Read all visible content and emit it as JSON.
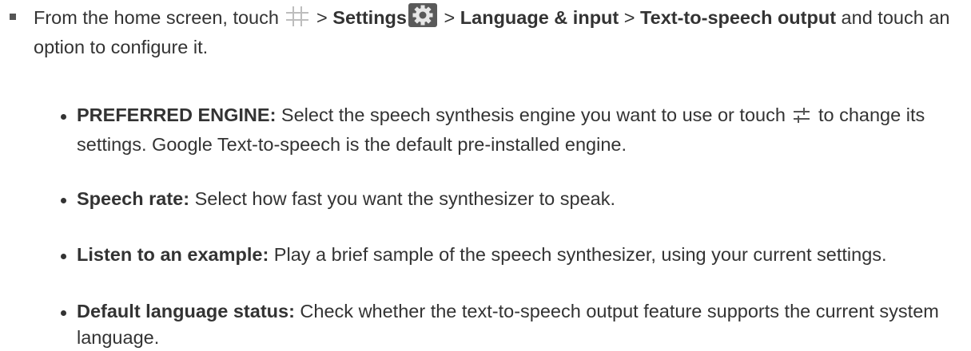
{
  "main_step": {
    "pre": "From the home screen, touch ",
    "sep1": " > ",
    "settings": "Settings",
    "sep2": " > ",
    "language_input": "Language & input",
    "sep3": " > ",
    "tts_output": "Text-to-speech output",
    "post": " and touch an option to configure it."
  },
  "icons": {
    "apps": "apps-grid-icon",
    "settings": "settings-gear-icon",
    "engine_settings": "engine-settings-sliders-icon"
  },
  "options": [
    {
      "term": "PREFERRED ENGINE:",
      "desc_a": " Select the speech synthesis engine you want to use or touch ",
      "desc_b": " to change its settings. Google Text-to-speech is the default pre-installed engine."
    },
    {
      "term": "Speech rate:",
      "desc": " Select how fast you want the synthesizer to speak."
    },
    {
      "term": "Listen to an example:",
      "desc": " Play a brief sample of the speech synthesizer, using your current settings."
    },
    {
      "term": "Default language status:",
      "desc": " Check whether the text-to-speech output feature supports the current system language."
    }
  ]
}
